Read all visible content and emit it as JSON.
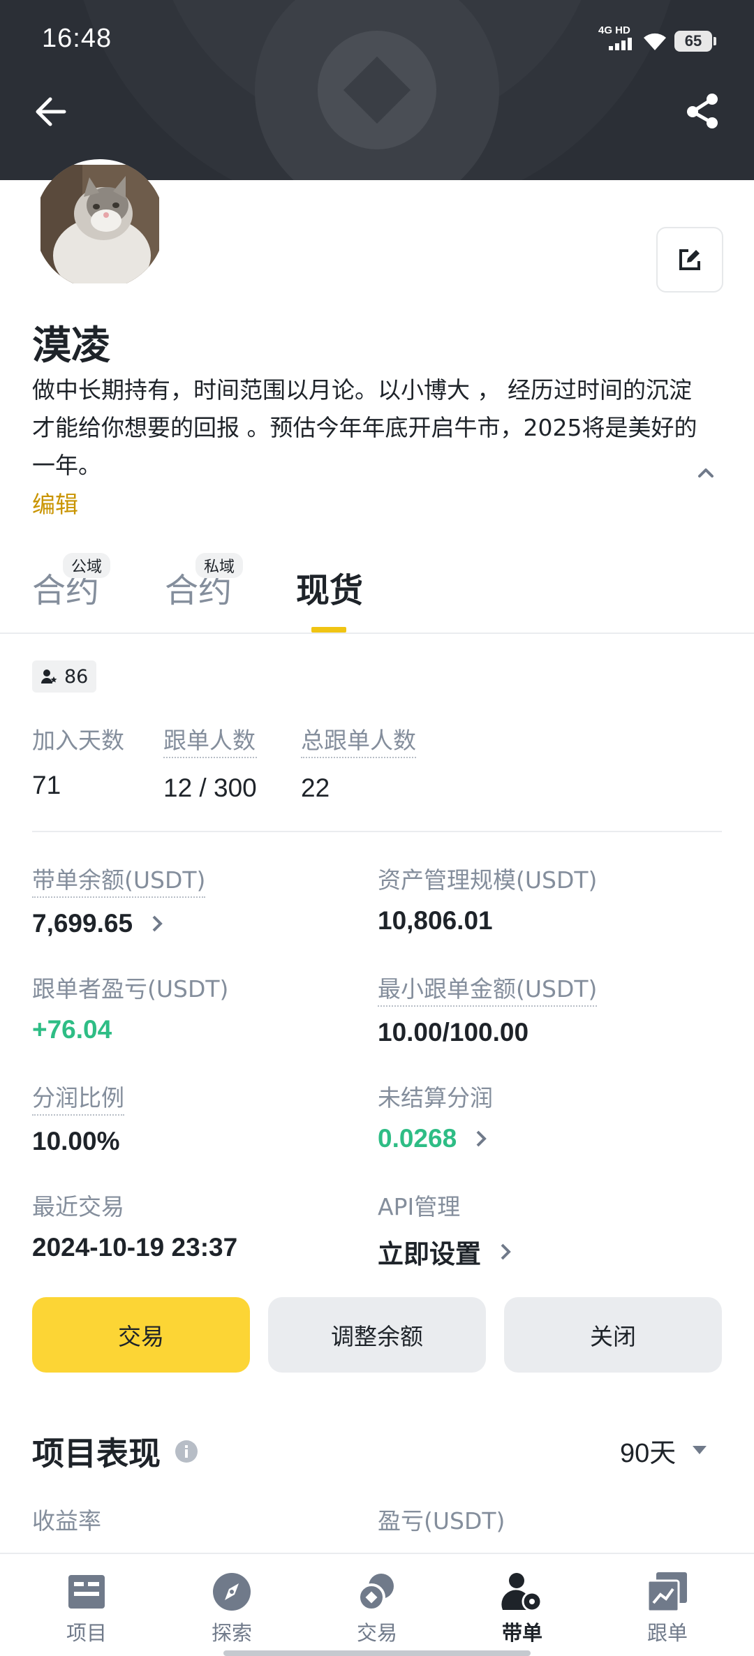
{
  "status_bar": {
    "time": "16:48",
    "network": "4G HD",
    "battery": "65"
  },
  "profile": {
    "name": "漠凌",
    "bio": "做中长期持有，时间范围以月论。以小博大 ， 经历过时间的沉淀才能给你想要的回报 。预估今年年底开启牛市，2025将是美好的一年。",
    "edit_label": "编辑"
  },
  "tabs": [
    {
      "label": "合约",
      "badge": "公域"
    },
    {
      "label": "合约",
      "badge": "私域"
    },
    {
      "label": "现货",
      "badge": ""
    }
  ],
  "followers_chip": "86",
  "stats": [
    {
      "label": "加入天数",
      "value": "71"
    },
    {
      "label": "跟单人数",
      "value": "12 / 300"
    },
    {
      "label": "总跟单人数",
      "value": "22"
    }
  ],
  "metrics": {
    "lead_balance": {
      "label": "带单余额(USDT)",
      "value": "7,699.65"
    },
    "aum": {
      "label": "资产管理规模(USDT)",
      "value": "10,806.01"
    },
    "follower_pnl": {
      "label": "跟单者盈亏(USDT)",
      "value": "+76.04"
    },
    "min_copy": {
      "label": "最小跟单金额(USDT)",
      "value": "10.00/100.00"
    },
    "profit_share": {
      "label": "分润比例",
      "value": "10.00%"
    },
    "unsettled": {
      "label": "未结算分润",
      "value": "0.0268"
    },
    "last_trade": {
      "label": "最近交易",
      "value": "2024-10-19 23:37"
    },
    "api": {
      "label": "API管理",
      "value": "立即设置"
    }
  },
  "actions": {
    "trade": "交易",
    "adjust": "调整余额",
    "close": "关闭"
  },
  "performance": {
    "title": "项目表现",
    "period": "90天",
    "col_left": "收益率",
    "col_right": "盈亏(USDT)"
  },
  "bottom_nav": [
    {
      "label": "项目",
      "icon": "projects-icon"
    },
    {
      "label": "探索",
      "icon": "compass-icon"
    },
    {
      "label": "交易",
      "icon": "trade-icon"
    },
    {
      "label": "带单",
      "icon": "lead-icon"
    },
    {
      "label": "跟单",
      "icon": "copy-icon"
    }
  ],
  "colors": {
    "brand_yellow": "#fcd535",
    "profit_green": "#2ebd85",
    "link_gold": "#c99400"
  }
}
